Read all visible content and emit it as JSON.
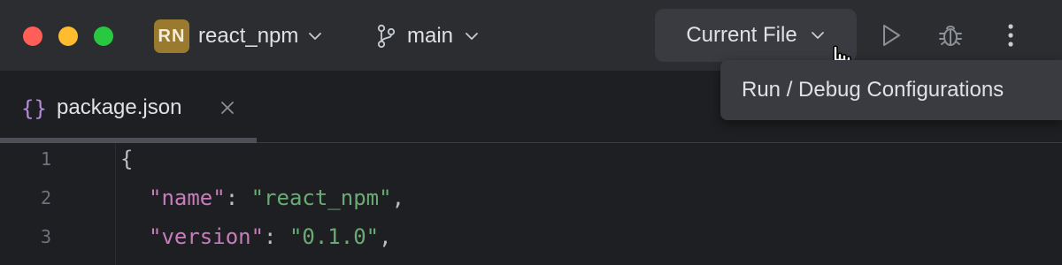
{
  "titlebar": {
    "project": {
      "initials": "RN",
      "name": "react_npm"
    },
    "branch": {
      "name": "main"
    },
    "run_config": {
      "label": "Current File"
    },
    "tooltip": "Run / Debug Configurations"
  },
  "tabs": [
    {
      "icon": "{}",
      "label": "package.json"
    }
  ],
  "editor": {
    "lines": [
      {
        "num": "1",
        "brace": "{"
      },
      {
        "num": "2",
        "key": "\"name\"",
        "sep": ": ",
        "value": "\"react_npm\"",
        "end": ","
      },
      {
        "num": "3",
        "key": "\"version\"",
        "sep": ": ",
        "value": "\"0.1.0\"",
        "end": ","
      }
    ]
  },
  "colors": {
    "titlebar_bg": "#2b2d30",
    "editor_bg": "#1e1f22",
    "project_badge": "#9a7a2e",
    "json_key": "#c77dbb",
    "json_string": "#6aab73",
    "line_number": "#6f737a"
  },
  "icons": {
    "window_controls": [
      "close-icon",
      "minimize-icon",
      "zoom-icon"
    ],
    "branch": "git-branch-icon",
    "run": "play-icon",
    "debug": "bug-icon",
    "more": "more-vertical-icon",
    "tab_file": "json-braces-icon",
    "tab_close": "close-icon"
  }
}
